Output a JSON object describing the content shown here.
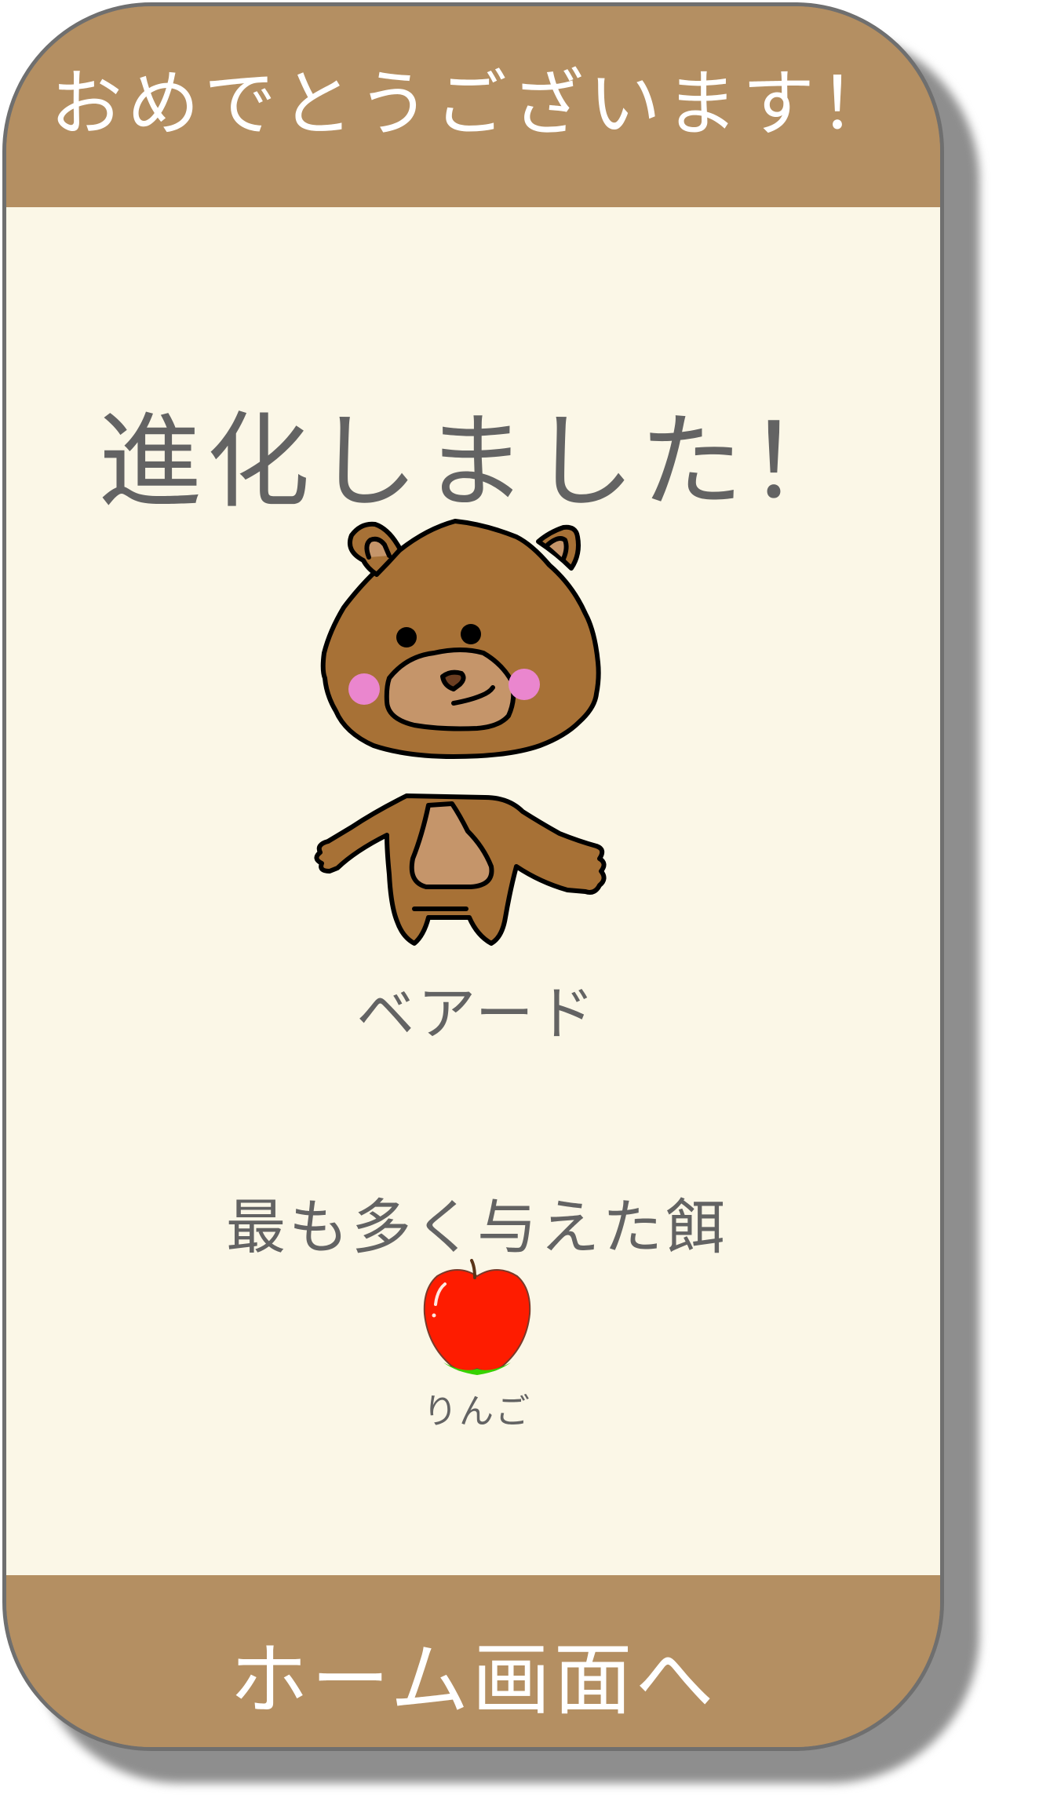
{
  "header": {
    "title": "おめでとうございます！"
  },
  "main": {
    "evolved_text": "進化しました！",
    "creature_name": "ベアード",
    "creature_icon": "bear-character",
    "feed_label": "最も多く与えた餌",
    "feed_name": "りんご",
    "feed_icon": "apple-icon"
  },
  "footer": {
    "home_button_label": "ホーム画面へ"
  },
  "colors": {
    "frame": "#b48f62",
    "background": "#fbf7e7",
    "border": "#6f6f6f",
    "text_dark": "#636363",
    "text_light": "#ffffff"
  }
}
